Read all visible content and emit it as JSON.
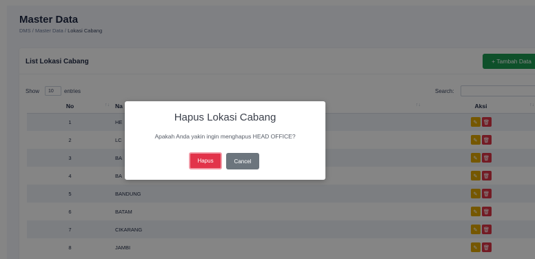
{
  "page": {
    "title": "Master Data",
    "breadcrumb": [
      "DMS",
      "Master Data",
      "Lokasi Cabang"
    ],
    "breadcrumb_sep": "/"
  },
  "card": {
    "title": "List Lokasi Cabang",
    "add_button": "+ Tambah Data"
  },
  "table_controls": {
    "show_label": "Show",
    "entries_value": "10",
    "entries_label": "entries",
    "search_label": "Search:"
  },
  "table": {
    "columns": [
      "No",
      "Na",
      "Aksi"
    ],
    "rows": [
      {
        "no": "1",
        "name": "HE"
      },
      {
        "no": "2",
        "name": "LC"
      },
      {
        "no": "3",
        "name": "BA"
      },
      {
        "no": "4",
        "name": "BA"
      },
      {
        "no": "5",
        "name": "BANDUNG"
      },
      {
        "no": "6",
        "name": "BATAM"
      },
      {
        "no": "7",
        "name": "CIKARANG"
      },
      {
        "no": "8",
        "name": "JAMBI"
      }
    ]
  },
  "modal": {
    "title": "Hapus Lokasi Cabang",
    "message": "Apakah Anda yakin ingin menghapus HEAD OFFICE?",
    "confirm_label": "Hapus",
    "cancel_label": "Cancel"
  },
  "colors": {
    "add_button": "#1c9a51",
    "edit_button": "#e0a800",
    "delete_button": "#dc3545",
    "cancel_button": "#6c757d"
  }
}
